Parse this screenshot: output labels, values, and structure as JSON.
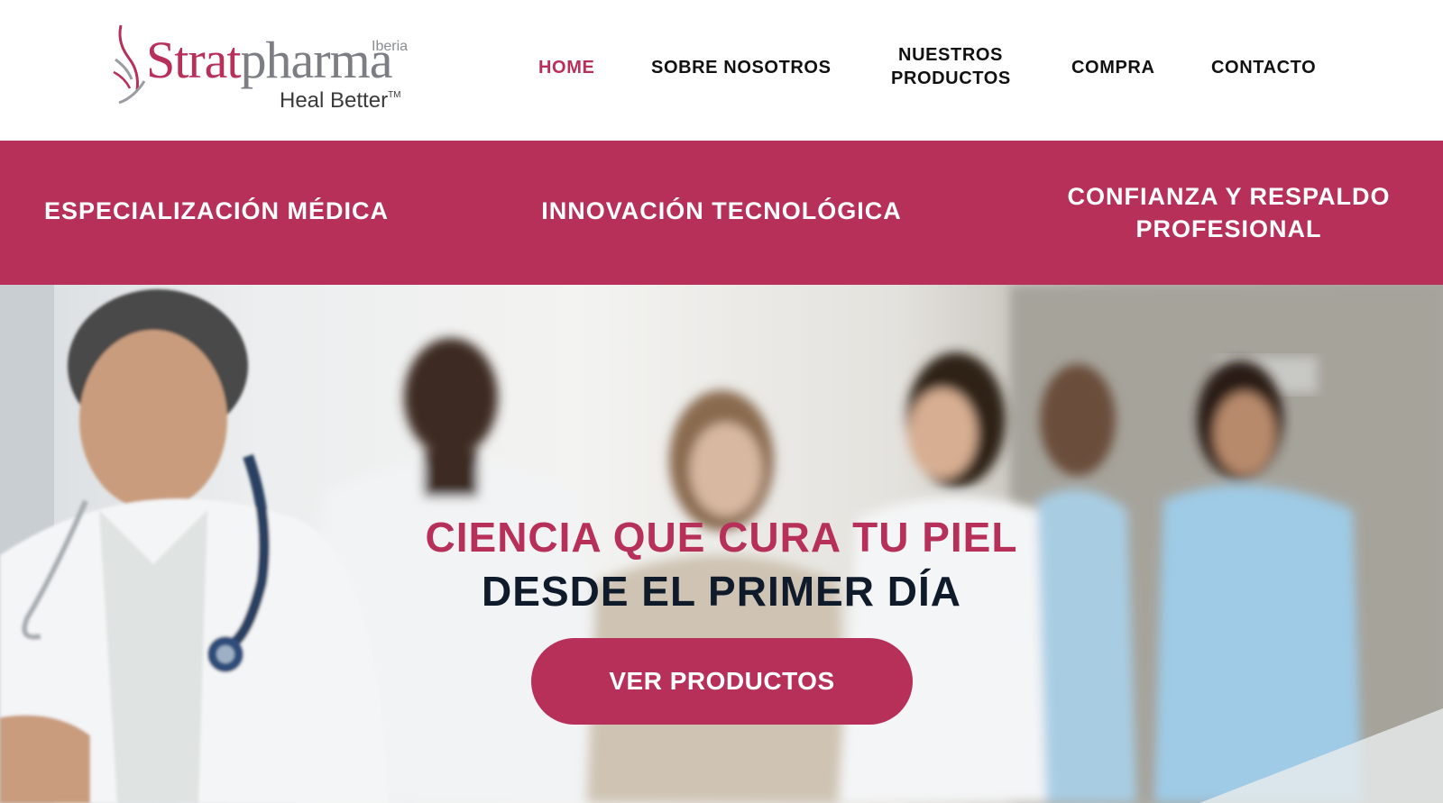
{
  "logo": {
    "brand_part1": "Strat",
    "brand_part2": "pharma",
    "region": "Iberia",
    "tagline": "Heal Better",
    "trademark": "TM"
  },
  "nav": {
    "items": [
      {
        "label": "HOME",
        "active": true
      },
      {
        "label": "SOBRE NOSOTROS",
        "active": false
      },
      {
        "label": "NUESTROS PRODUCTOS",
        "active": false
      },
      {
        "label": "COMPRA",
        "active": false
      },
      {
        "label": "CONTACTO",
        "active": false
      }
    ]
  },
  "banner": {
    "items": [
      {
        "label": "ESPECIALIZACIÓN MÉDICA"
      },
      {
        "label": "INNOVACIÓN TECNOLÓGICA"
      },
      {
        "label": "CONFIANZA Y RESPALDO PROFESIONAL"
      }
    ]
  },
  "hero": {
    "title_line1": "CIENCIA QUE CURA TU PIEL",
    "title_line2": "DESDE EL PRIMER DÍA",
    "cta_label": "VER PRODUCTOS",
    "image_icon": "medical-team-photo"
  },
  "colors": {
    "brand": "#b6305a",
    "nav_text": "#111111",
    "hero_dark_text": "#0f1a2b",
    "logo_gray": "#7c7e84"
  }
}
